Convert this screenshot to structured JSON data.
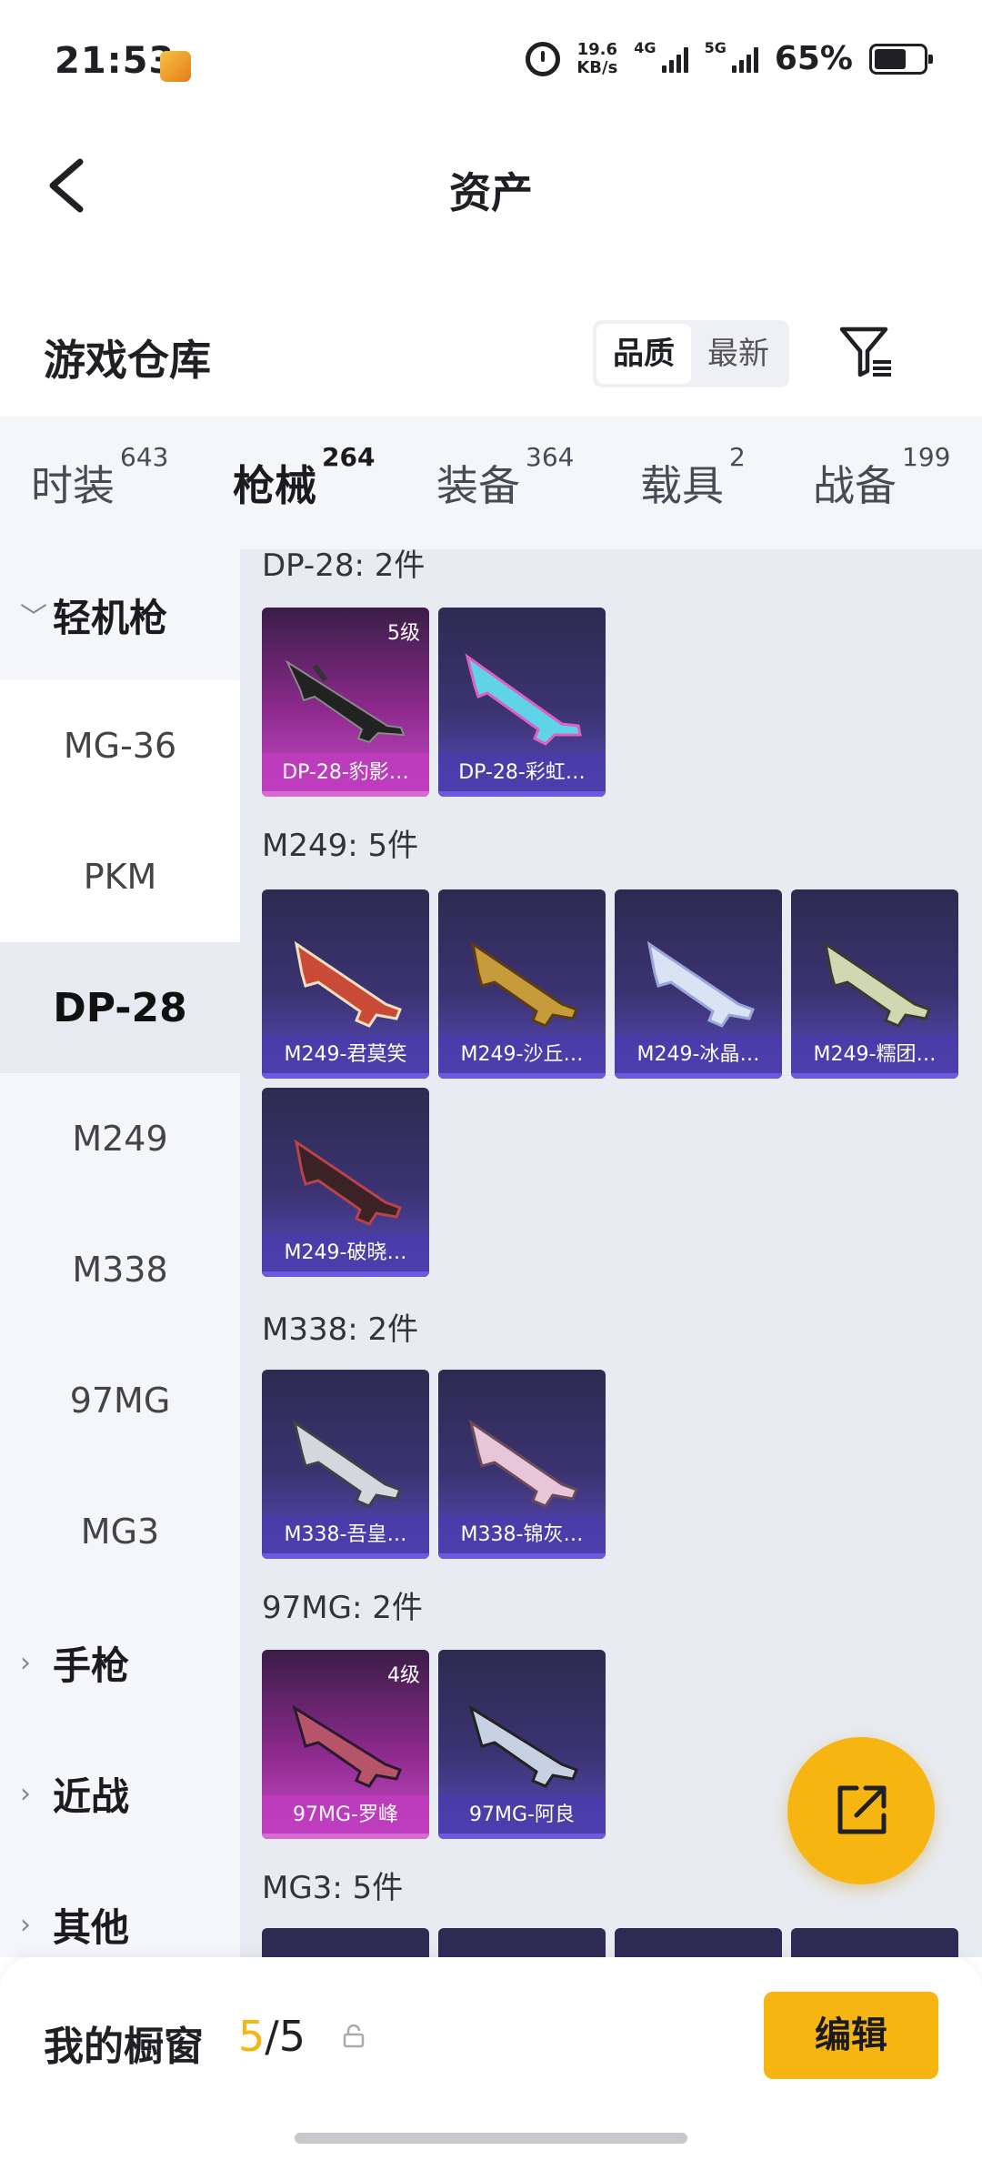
{
  "status_bar": {
    "time": "21:53",
    "speed_value": "19.6",
    "speed_unit": "KB/s",
    "net1": "4G",
    "net2": "5G",
    "battery": "65%",
    "battery_level": 0.65
  },
  "header": {
    "title": "资产",
    "back_icon": "chevron-left-icon"
  },
  "warehouse": {
    "title": "游戏仓库",
    "sort_options": [
      "品质",
      "最新"
    ],
    "sort_selected": "品质",
    "filter_icon": "filter-icon"
  },
  "category_tabs": [
    {
      "label": "时装",
      "count": "643"
    },
    {
      "label": "枪械",
      "count": "264",
      "active": true
    },
    {
      "label": "装备",
      "count": "364"
    },
    {
      "label": "载具",
      "count": "2"
    },
    {
      "label": "战备",
      "count": "199"
    }
  ],
  "sidebar": {
    "groups": [
      {
        "label": "轻机枪",
        "expanded": true,
        "caret": "chevron-down-icon"
      },
      {
        "label": "手枪",
        "caret": "chevron-right-icon"
      },
      {
        "label": "近战",
        "caret": "chevron-right-icon"
      },
      {
        "label": "其他",
        "caret": "chevron-right-icon"
      }
    ],
    "sub_items": [
      "MG-36",
      "PKM",
      "DP-28",
      "M249",
      "M338",
      "97MG",
      "MG3"
    ],
    "active_sub": "DP-28"
  },
  "sections": [
    {
      "title": "DP-28: 2件",
      "items": [
        {
          "name": "DP-28-豹影…",
          "level": "5级",
          "rarity": "pink"
        },
        {
          "name": "DP-28-彩虹…",
          "rarity": "purple"
        }
      ]
    },
    {
      "title": "M249: 5件",
      "items": [
        {
          "name": "M249-君莫笑",
          "rarity": "purple"
        },
        {
          "name": "M249-沙丘…",
          "rarity": "purple"
        },
        {
          "name": "M249-冰晶…",
          "rarity": "purple"
        },
        {
          "name": "M249-糯团…",
          "rarity": "purple"
        },
        {
          "name": "M249-破晓…",
          "rarity": "purple"
        }
      ]
    },
    {
      "title": "M338: 2件",
      "items": [
        {
          "name": "M338-吾皇…",
          "rarity": "purple"
        },
        {
          "name": "M338-锦灰…",
          "rarity": "purple"
        }
      ]
    },
    {
      "title": "97MG: 2件",
      "items": [
        {
          "name": "97MG-罗峰",
          "level": "4级",
          "rarity": "pink"
        },
        {
          "name": "97MG-阿良",
          "rarity": "purple"
        }
      ]
    },
    {
      "title": "MG3: 5件",
      "items": []
    }
  ],
  "fab": {
    "icon": "share-icon"
  },
  "bottom_bar": {
    "label": "我的橱窗",
    "used": "5",
    "separator": "/",
    "total": "5",
    "lock_icon": "lock-icon",
    "edit_label": "编辑"
  }
}
